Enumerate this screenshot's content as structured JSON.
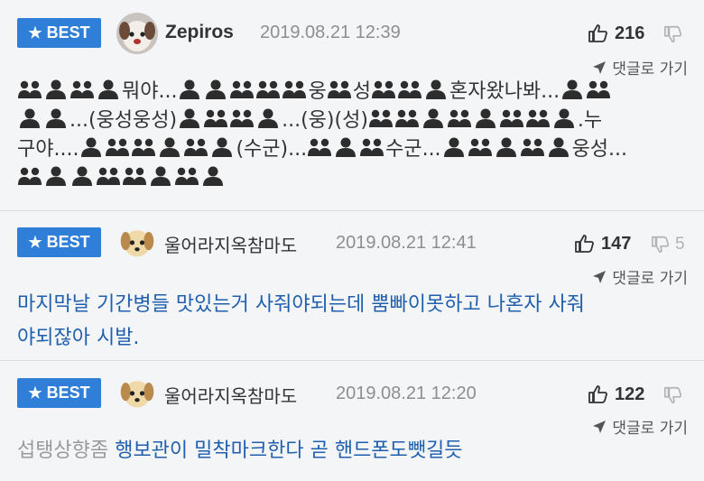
{
  "badge_label": "BEST",
  "colors": {
    "badge": "#2f7ed8",
    "link_text": "#1f5fae",
    "date": "#8e8e8e"
  },
  "icons": {
    "like": "thumbs-up-icon",
    "dislike": "thumbs-down-icon",
    "reply": "reply-arrow-icon",
    "person": "person-icon",
    "people": "people-icon"
  },
  "comments": [
    {
      "nickname": "Zepiros",
      "date": "2019.08.21 12:39",
      "likes": "216",
      "dislikes": "",
      "reply_label": "댓글로 가기",
      "body_line1": "뭐야...",
      "body_line1b": "웅",
      "body_line1c": "성",
      "body_line1d": "혼자왔나봐...",
      "body_line2a": "...(웅성웅성)",
      "body_line2b": "...(웅)(성)",
      "body_line2c": ".누",
      "body_line3a": "구야....",
      "body_line3b": "(수군)...",
      "body_line3c": "수군...",
      "body_line3d": "웅성..."
    },
    {
      "nickname": "울어라지옥참마도",
      "date": "2019.08.21 12:41",
      "likes": "147",
      "dislikes": "5",
      "reply_label": "댓글로 가기",
      "body_line1": "마지막날 기간병들 맛있는거 사줘야되는데 뿜빠이못하고 나혼자 사줘",
      "body_line2": "야되잖아 시발."
    },
    {
      "nickname": "울어라지옥참마도",
      "date": "2019.08.21 12:20",
      "likes": "122",
      "dislikes": "",
      "reply_label": "댓글로 가기",
      "filtered": "섭탱상향좀",
      "body": "행보관이 밀착마크한다 곧 핸드폰도뺏길듯"
    }
  ]
}
